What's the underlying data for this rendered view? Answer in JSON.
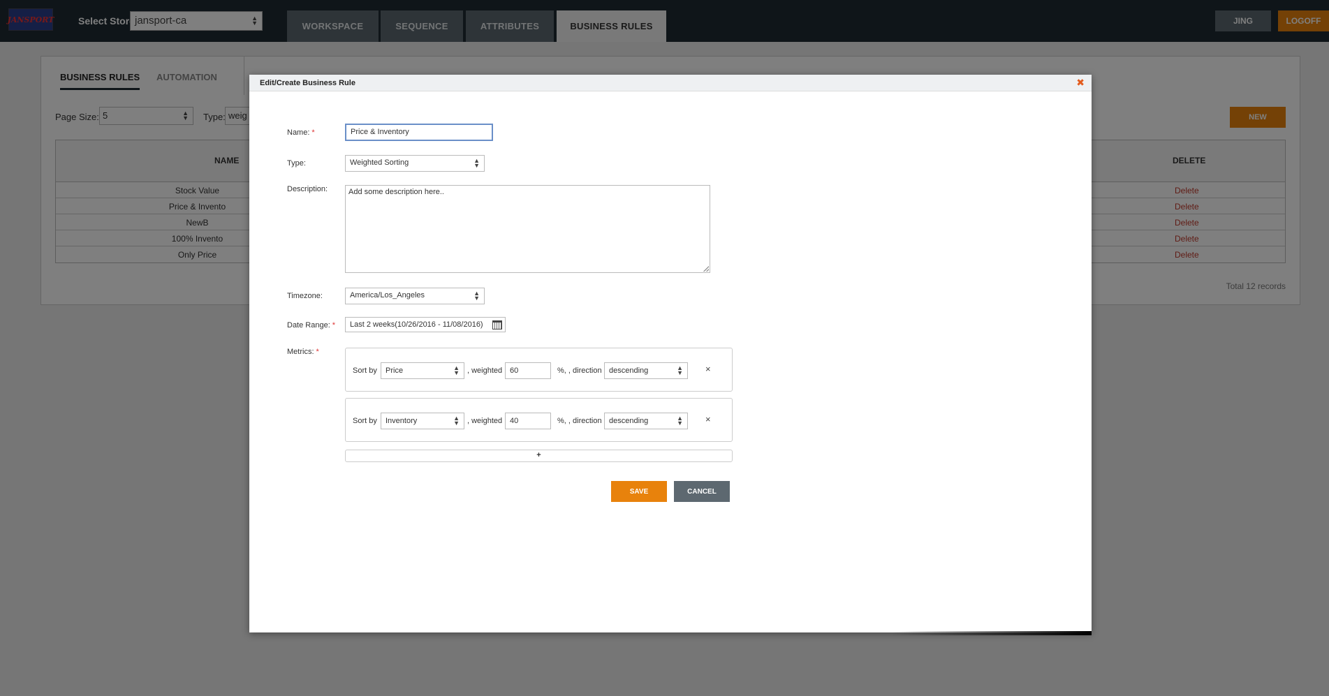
{
  "topbar": {
    "logo_text": "JANSPORT",
    "store_label": "Select Store",
    "store_value": "jansport-ca",
    "tabs": [
      {
        "label": "WORKSPACE"
      },
      {
        "label": "SEQUENCE"
      },
      {
        "label": "ATTRIBUTES"
      },
      {
        "label": "BUSINESS RULES"
      }
    ],
    "user_button": "JING",
    "logoff_button": "LOGOFF"
  },
  "background": {
    "subtabs": [
      {
        "label": "BUSINESS RULES"
      },
      {
        "label": "AUTOMATION"
      }
    ],
    "page_size_label": "Page Size:",
    "page_size_value": "5",
    "type_label": "Type:",
    "type_value": "weig",
    "new_button": "NEW",
    "table": {
      "headers": {
        "name": "NAME",
        "delete": "DELETE"
      },
      "rows": [
        {
          "name": "Stock Value",
          "action": "Delete"
        },
        {
          "name": "Price & Invento",
          "action": "Delete"
        },
        {
          "name": "NewB",
          "action": "Delete"
        },
        {
          "name": "100% Invento",
          "action": "Delete"
        },
        {
          "name": "Only Price",
          "action": "Delete"
        }
      ]
    },
    "total_records": "Total 12 records"
  },
  "modal": {
    "title": "Edit/Create Business Rule",
    "close_glyph": "✖",
    "name_label": "Name:",
    "name_value": "Price & Inventory",
    "type_label": "Type:",
    "type_value": "Weighted Sorting",
    "description_label": "Description:",
    "description_value": "Add some description here..",
    "timezone_label": "Timezone:",
    "timezone_value": "America/Los_Angeles",
    "date_range_label": "Date Range:",
    "date_range_value": "Last 2 weeks(10/26/2016 - 11/08/2016)",
    "metrics_label": "Metrics:",
    "metrics": [
      {
        "sort_by_label": "Sort by",
        "sort_by": "Price",
        "weighted_label": ", weighted",
        "weight": "60",
        "direction_label": "%, , direction",
        "direction": "descending"
      },
      {
        "sort_by_label": "Sort by",
        "sort_by": "Inventory",
        "weighted_label": ", weighted",
        "weight": "40",
        "direction_label": "%, , direction",
        "direction": "descending"
      }
    ],
    "remove_glyph": "×",
    "add_glyph": "+",
    "save_button": "SAVE",
    "cancel_button": "CANCEL",
    "required_mark": "*"
  },
  "colors": {
    "accent": "#e8820c",
    "topbar": "#1f2a33",
    "nav_tab": "#5d6870",
    "cancel": "#5d6870",
    "delete_link": "#c0392b",
    "close": "#e35b1d"
  }
}
